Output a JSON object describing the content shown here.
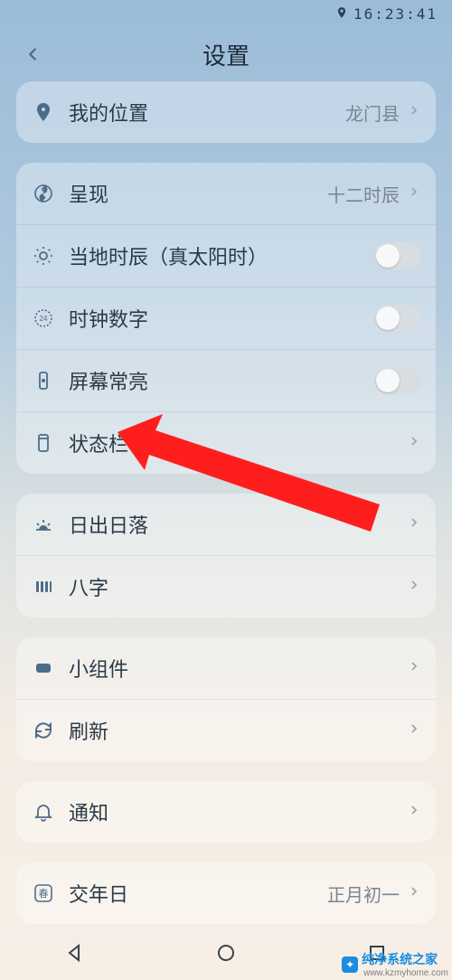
{
  "status": {
    "time": "16:23:41"
  },
  "header": {
    "title": "设置"
  },
  "groups": [
    {
      "rows": [
        {
          "icon": "location-pin-icon",
          "label": "我的位置",
          "value": "龙门县",
          "accessory": "chevron"
        }
      ]
    },
    {
      "rows": [
        {
          "icon": "yinyang-icon",
          "label": "呈现",
          "value": "十二时辰",
          "accessory": "chevron"
        },
        {
          "icon": "sun-icon",
          "label": "当地时辰（真太阳时）",
          "accessory": "toggle",
          "toggle_on": false
        },
        {
          "icon": "clock24-icon",
          "label": "时钟数字",
          "accessory": "toggle",
          "toggle_on": false
        },
        {
          "icon": "phone-bright-icon",
          "label": "屏幕常亮",
          "accessory": "toggle",
          "toggle_on": false
        },
        {
          "icon": "statusbar-icon",
          "label": "状态栏",
          "accessory": "chevron"
        }
      ]
    },
    {
      "rows": [
        {
          "icon": "sunrise-icon",
          "label": "日出日落",
          "accessory": "chevron"
        },
        {
          "icon": "bazi-icon",
          "label": "八字",
          "accessory": "chevron"
        }
      ]
    },
    {
      "rows": [
        {
          "icon": "widget-icon",
          "label": "小组件",
          "accessory": "chevron"
        },
        {
          "icon": "refresh-icon",
          "label": "刷新",
          "accessory": "chevron"
        }
      ]
    },
    {
      "rows": [
        {
          "icon": "bell-icon",
          "label": "通知",
          "accessory": "chevron"
        }
      ]
    },
    {
      "rows": [
        {
          "icon": "spring-icon",
          "label": "交年日",
          "value": "正月初一",
          "accessory": "chevron"
        }
      ]
    }
  ],
  "watermark": {
    "text": "纯净系统之家",
    "url": "www.kzmyhome.com"
  },
  "annotation": {
    "arrow_color": "#ff1e1e"
  }
}
